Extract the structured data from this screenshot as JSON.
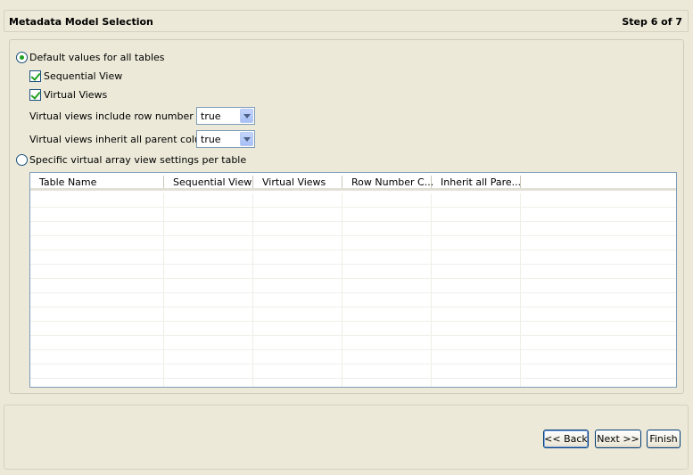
{
  "header": {
    "title": "Metadata Model Selection",
    "step": "Step 6 of 7"
  },
  "options": {
    "default_radio_label": "Default values for all tables",
    "sequential_view_label": "Sequential View",
    "sequential_view_checked": true,
    "virtual_views_label": "Virtual Views",
    "virtual_views_checked": true,
    "row_number_label": "Virtual views include row number",
    "row_number_value": "true",
    "inherit_label": "Virtual views inherit all parent columns",
    "inherit_value": "true",
    "specific_radio_label": "Specific virtual array view settings per table",
    "selected_mode": "default"
  },
  "table": {
    "columns": [
      "Table Name",
      "Sequential View",
      "Virtual Views",
      "Row Number C...",
      "Inherit all Pare..."
    ],
    "rows": []
  },
  "footer": {
    "back_label": "<< Back",
    "next_label": "Next >>",
    "finish_label": "Finish"
  },
  "colors": {
    "background": "#ece9d8",
    "check_green": "#21a121",
    "border_blue": "#7f9db9"
  }
}
